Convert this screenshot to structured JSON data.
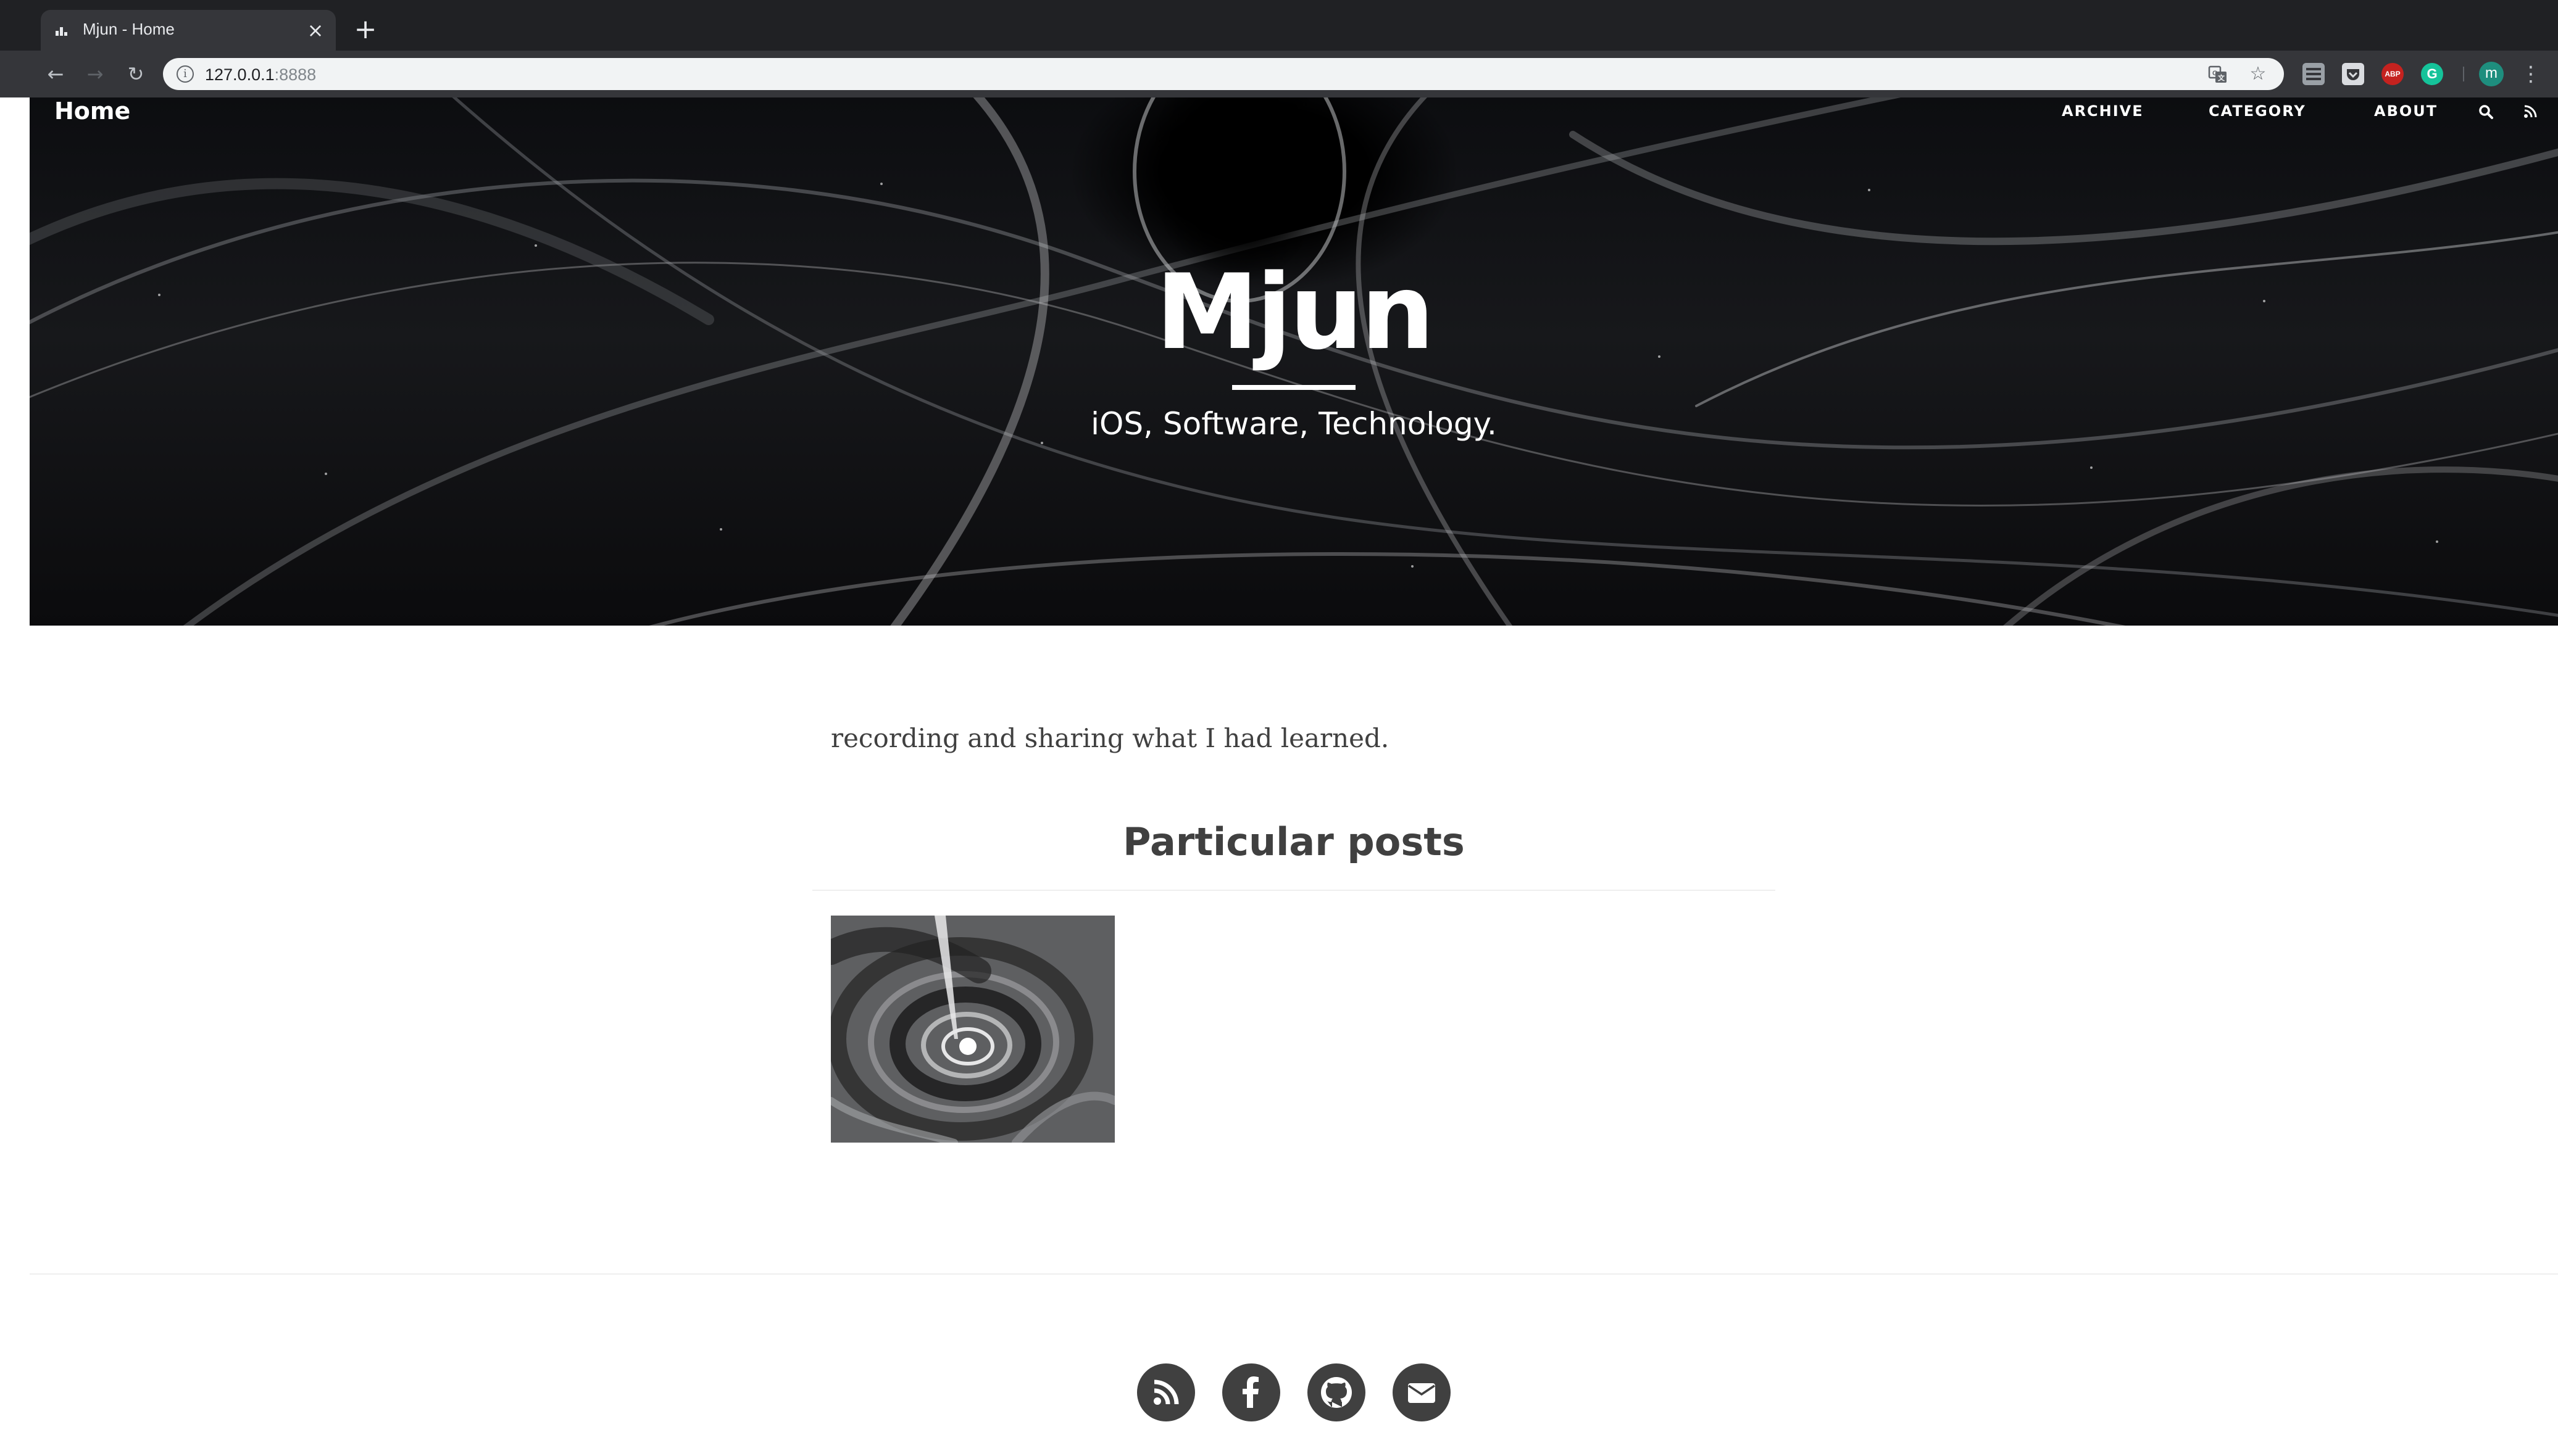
{
  "browser": {
    "tab_title": "Mjun - Home",
    "tab_close": "×",
    "new_tab": "+",
    "url_host": "127.0.0.1",
    "url_port": ":8888",
    "back_glyph": "←",
    "forward_glyph": "→",
    "reload_glyph": "↻",
    "bookmark_glyph": "☆",
    "menu_glyph": "⋮",
    "profile_initial": "m",
    "extensions": [
      {
        "name": "reader-extension-icon",
        "label": "",
        "color": "#9aa0a6"
      },
      {
        "name": "pocket-extension-icon",
        "label": "",
        "color": "#dadce0"
      },
      {
        "name": "adblock-plus-icon",
        "label": "ABP",
        "color": "#c5221f"
      },
      {
        "name": "grammarly-icon",
        "label": "G",
        "color": "#15c39a"
      }
    ]
  },
  "site": {
    "brand": "Home",
    "nav": {
      "archive": "ARCHIVE",
      "category": "CATEGORY",
      "about": "ABOUT"
    },
    "hero_title": "Mjun",
    "hero_subtitle": "iOS, Software, Technology.",
    "intro": "recording and sharing what I had learned.",
    "section_title": "Particular posts"
  },
  "footer": {
    "social_icons": [
      "rss-icon",
      "facebook-icon",
      "github-icon",
      "email-icon"
    ]
  },
  "colors": {
    "text": "#404040",
    "chrome_bg": "#202124",
    "toolbar_bg": "#35363a",
    "omnibox_bg": "#f1f3f4"
  }
}
